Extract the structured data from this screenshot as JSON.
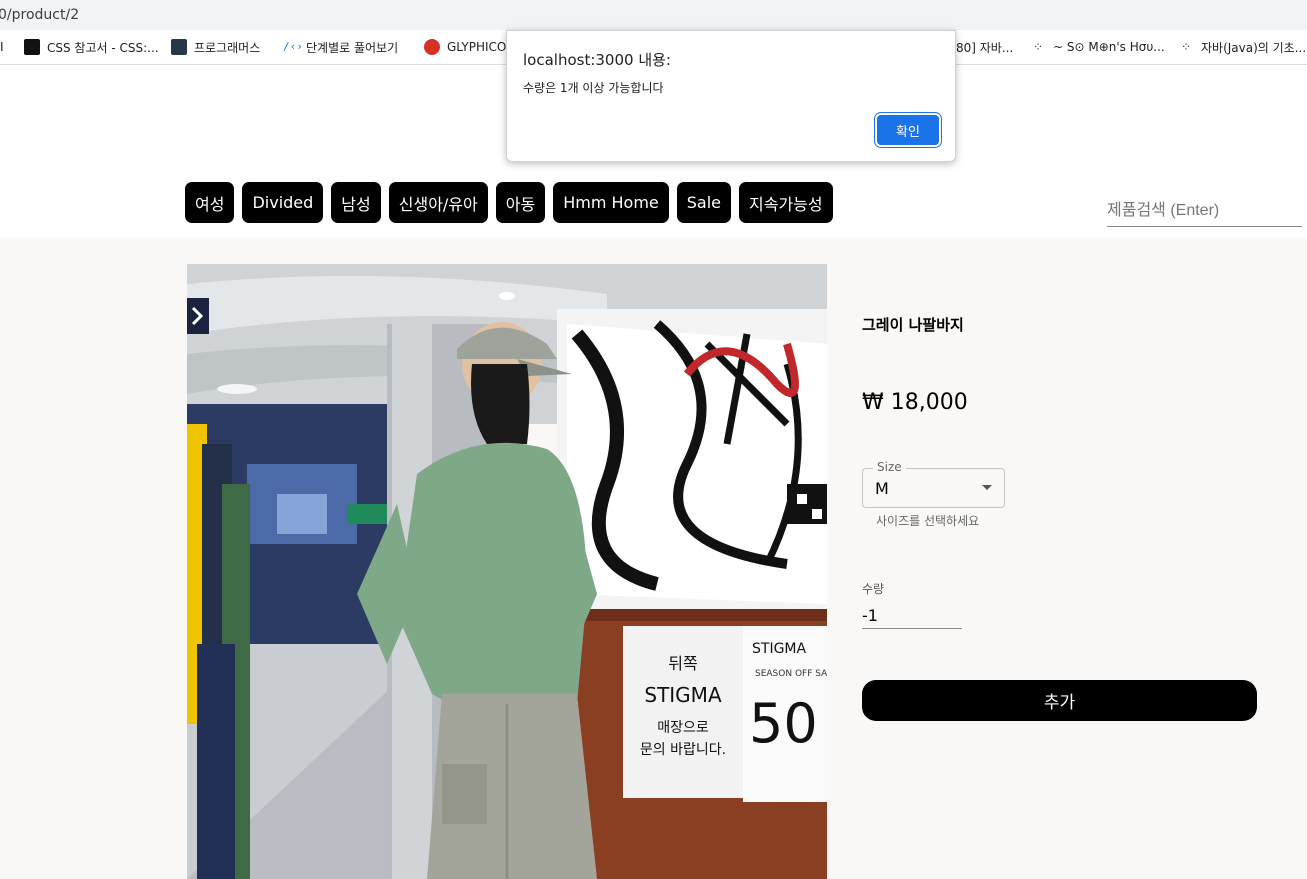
{
  "browser": {
    "url": "0/product/2",
    "bookmarks": [
      {
        "label": "I",
        "icon": ""
      },
      {
        "label": "CSS 참고서 - CSS:...",
        "icon": "css-icon"
      },
      {
        "label": "프로그래머스",
        "icon": "programmers-icon"
      },
      {
        "label": "단계별로 풀어보기",
        "icon": "code-icon"
      },
      {
        "label": "GLYPHICO",
        "icon": "glyphicons-icon"
      },
      {
        "label": "80] 자바...",
        "icon": ""
      },
      {
        "label": "~ S⊙ M⊕n's Hσυ...",
        "icon": "dots-icon"
      },
      {
        "label": "자바(Java)의 기초...",
        "icon": "dots-icon"
      }
    ]
  },
  "nav": {
    "items": [
      "여성",
      "Divided",
      "남성",
      "신생아/유아",
      "아동",
      "Hmm Home",
      "Sale",
      "지속가능성"
    ]
  },
  "search": {
    "placeholder": "제품검색 (Enter)"
  },
  "product": {
    "title": "그레이 나팔바지",
    "price": "₩ 18,000",
    "size_label": "Size",
    "size_value": "M",
    "size_help": "사이즈를 선택하세요",
    "quantity_label": "수량",
    "quantity_value": "-1",
    "add_button": "추가"
  },
  "dialog": {
    "title": "localhost:3000 내용:",
    "message": "수량은 1개 이상 가능합니다",
    "ok_label": "확인"
  },
  "photo_signs": {
    "sign1_line1": "뒤쪽",
    "sign1_line2": "STIGMA",
    "sign1_line3": "매장으로",
    "sign1_line4": "문의 바랍니다.",
    "sign2_brand": "STIGMA",
    "sign2_sub": "SEASON OFF SA",
    "sign2_big": "50"
  },
  "colors": {
    "accent": "#1a73e8",
    "nav_bg": "#000000",
    "page_bg": "#f9f8f6"
  }
}
